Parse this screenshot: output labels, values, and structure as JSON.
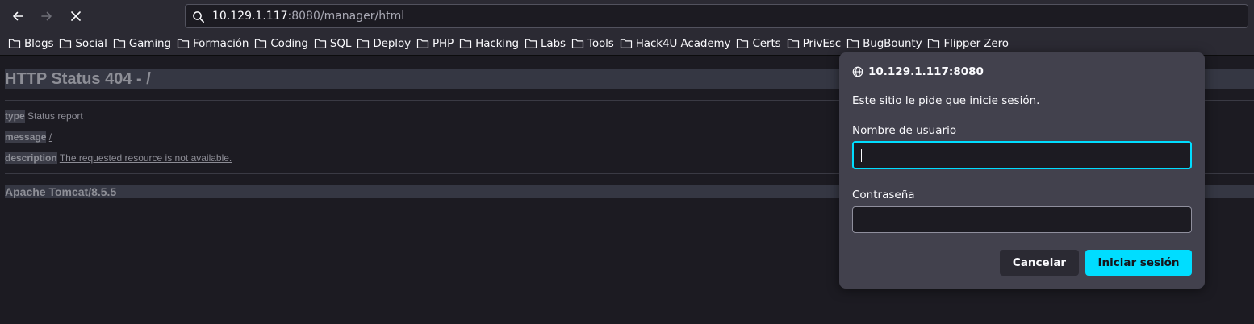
{
  "browser": {
    "url_host": "10.129.1.117",
    "url_rest": ":8080/manager/html"
  },
  "bookmarks": [
    {
      "label": "Blogs"
    },
    {
      "label": "Social"
    },
    {
      "label": "Gaming"
    },
    {
      "label": "Formación"
    },
    {
      "label": "Coding"
    },
    {
      "label": "SQL"
    },
    {
      "label": "Deploy"
    },
    {
      "label": "PHP"
    },
    {
      "label": "Hacking"
    },
    {
      "label": "Labs"
    },
    {
      "label": "Tools"
    },
    {
      "label": "Hack4U Academy"
    },
    {
      "label": "Certs"
    },
    {
      "label": "PrivEsc"
    },
    {
      "label": "BugBounty"
    },
    {
      "label": "Flipper Zero"
    }
  ],
  "page": {
    "title": "HTTP Status 404 - /",
    "type_label": "type",
    "type_value": "Status report",
    "message_label": "message",
    "message_value": "/",
    "description_label": "description",
    "description_value": "The requested resource is not available.",
    "server": "Apache Tomcat/8.5.5"
  },
  "dialog": {
    "site": "10.129.1.117:8080",
    "message": "Este sitio le pide que inicie sesión.",
    "username_label": "Nombre de usuario",
    "username_value": "",
    "password_label": "Contraseña",
    "password_value": "",
    "cancel_label": "Cancelar",
    "login_label": "Iniciar sesión"
  },
  "colors": {
    "accent": "#00ddff",
    "chrome": "#2b2a33",
    "page_bg": "#1c1b22",
    "dialog_bg": "#42414d"
  }
}
